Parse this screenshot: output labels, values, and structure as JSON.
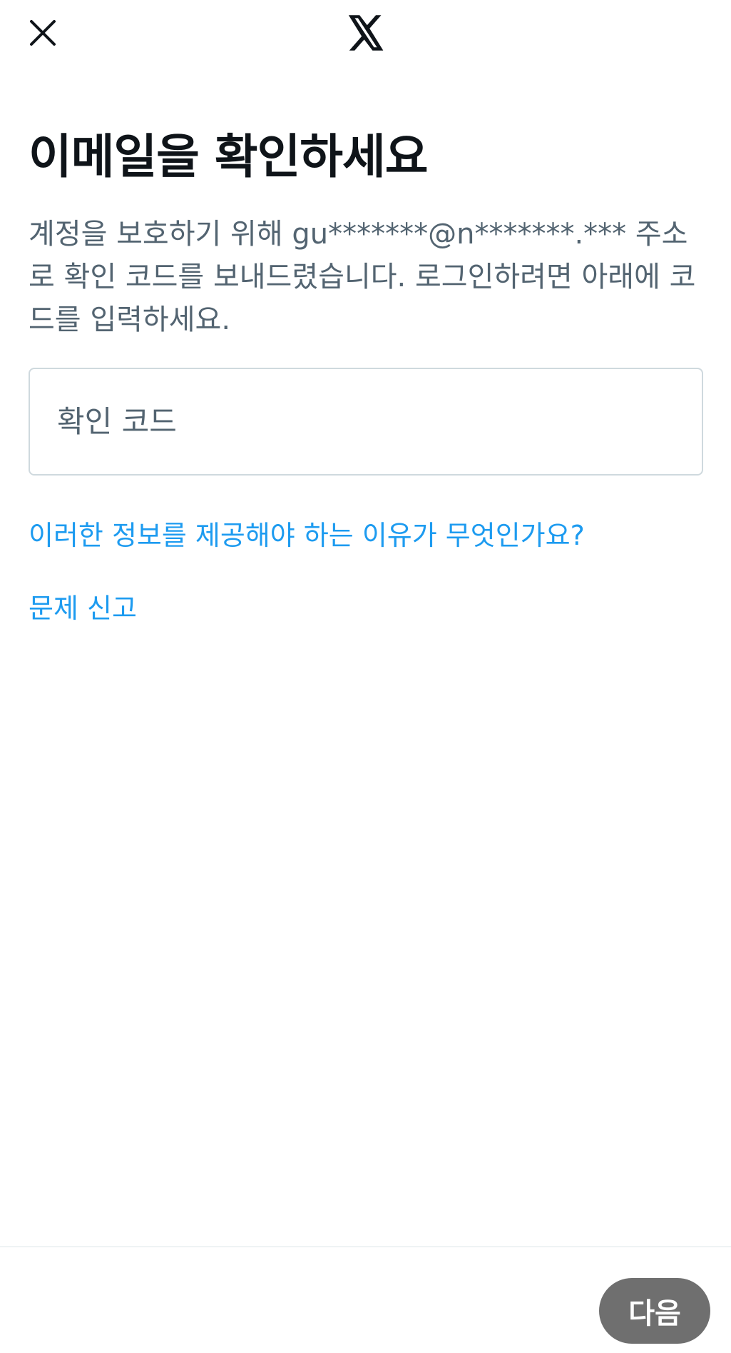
{
  "header": {
    "close_icon": "close-icon",
    "logo_icon": "x-logo-icon"
  },
  "main": {
    "title": "이메일을 확인하세요",
    "description": "계정을 보호하기 위해 gu*******@n*******.*** 주소로 확인 코드를 보내드렸습니다. 로그인하려면 아래에 코드를 입력하세요.",
    "code_input": {
      "placeholder": "확인 코드",
      "value": ""
    },
    "why_link": "이러한 정보를 제공해야 하는 이유가 무엇인가요?",
    "report_link": "문제 신고"
  },
  "footer": {
    "next_label": "다음"
  },
  "colors": {
    "link": "#1d9bf0",
    "text_primary": "#0f1419",
    "text_secondary": "#536471",
    "button_disabled": "#6f6f6f"
  }
}
